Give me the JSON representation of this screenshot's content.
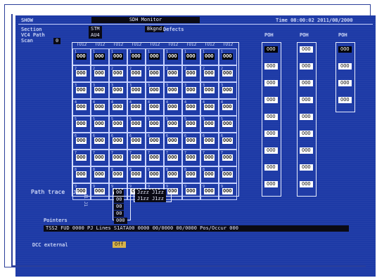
{
  "header": {
    "left_label": "SHOW",
    "center_title": "SDH Monitor",
    "time_text": "Time 08:00:02  2011/08/2000"
  },
  "section": {
    "row1_label": "Section",
    "row1_value": "STM",
    "row2_label": "VC4 Path",
    "row2_value": "AU4",
    "row3_label": "Scan",
    "row3_value": "0",
    "tag_label": "Bkgnd",
    "tag_value": "Defects"
  },
  "columns": [
    "TU12",
    "TU12",
    "TU12",
    "TU12",
    "TU12",
    "TU12",
    "TU12",
    "TU12",
    "TU12"
  ],
  "rows": [
    {
      "label": "1",
      "cells": [
        "OOO",
        "OOO",
        "OOO",
        "OOO",
        "OOO",
        "OOO",
        "OOO",
        "OOO",
        "OOO"
      ],
      "black": [
        0,
        1,
        2,
        3,
        4,
        5,
        6,
        7,
        8
      ]
    },
    {
      "label": "2",
      "cells": [
        "OOO",
        "OOO",
        "OOO",
        "OOO",
        "OOO",
        "OOO",
        "OOO",
        "OOO",
        "OOO"
      ],
      "black": []
    },
    {
      "label": "3",
      "cells": [
        "OOO",
        "OOO",
        "OOO",
        "OOO",
        "OOO",
        "OOO",
        "OOO",
        "OOO",
        "OOO"
      ],
      "black": []
    },
    {
      "label": "4",
      "cells": [
        "OOO",
        "OOO",
        "OOO",
        "OOO",
        "OOO",
        "OOO",
        "OOO",
        "OOO",
        "OOO"
      ],
      "black": []
    },
    {
      "label": "5",
      "cells": [
        "OOO",
        "OOO",
        "OOO",
        "OOO",
        "OOO",
        "OOO",
        "OOO",
        "OOO",
        "OOO"
      ],
      "black": []
    },
    {
      "label": "6",
      "cells": [
        "OOO",
        "OOO",
        "OOO",
        "OOO",
        "OOO",
        "OOO",
        "OOO",
        "OOO",
        "OOO"
      ],
      "black": []
    },
    {
      "label": "7",
      "cells": [
        "OOO",
        "OOO",
        "OOO",
        "OOO",
        "OOO",
        "OOO",
        "OOO",
        "OOO",
        "OOO"
      ],
      "black": []
    },
    {
      "label": "8",
      "cells": [
        "OOO",
        "OOO",
        "OOO",
        "OOO",
        "OOO",
        "OOO",
        "OOO",
        "OOO",
        "OOO"
      ],
      "black": []
    },
    {
      "label": "9",
      "cells": [
        "OOO",
        "OOO",
        "OOO",
        "OOO",
        "OOO",
        "OOO",
        "OOO",
        "OOO",
        "OOO"
      ],
      "black": []
    }
  ],
  "side_panels": [
    {
      "title": "POH",
      "cells": [
        "OOO",
        "OOO",
        "OOO",
        "OOO",
        "OOO",
        "OOO",
        "OOO",
        "OOO",
        "OOO"
      ]
    },
    {
      "title": "POH",
      "cells": [
        "OOO",
        "OOO",
        "OOO",
        "OOO",
        "OOO",
        "OOO",
        "OOO",
        "OOO",
        "OOO"
      ]
    },
    {
      "title": "POH",
      "cells": [
        "OOO",
        "OOO",
        "OOO",
        "OOO"
      ]
    }
  ],
  "path_trace": {
    "label": "Path trace",
    "side_label": "J1",
    "values": [
      "00",
      "00",
      "00",
      "00"
    ],
    "box1": "Jzzz  J1zz",
    "box2": "J1zz  J1zz"
  },
  "pointers": {
    "label": "Pointers",
    "value": "000",
    "bar_text": "TSS2 FUD 0000   PJ Lines  S1ATA00  0000 00/0000 00/0000 Pos/Occur    000"
  },
  "dcc": {
    "label": "DCC external",
    "value": "Off"
  }
}
